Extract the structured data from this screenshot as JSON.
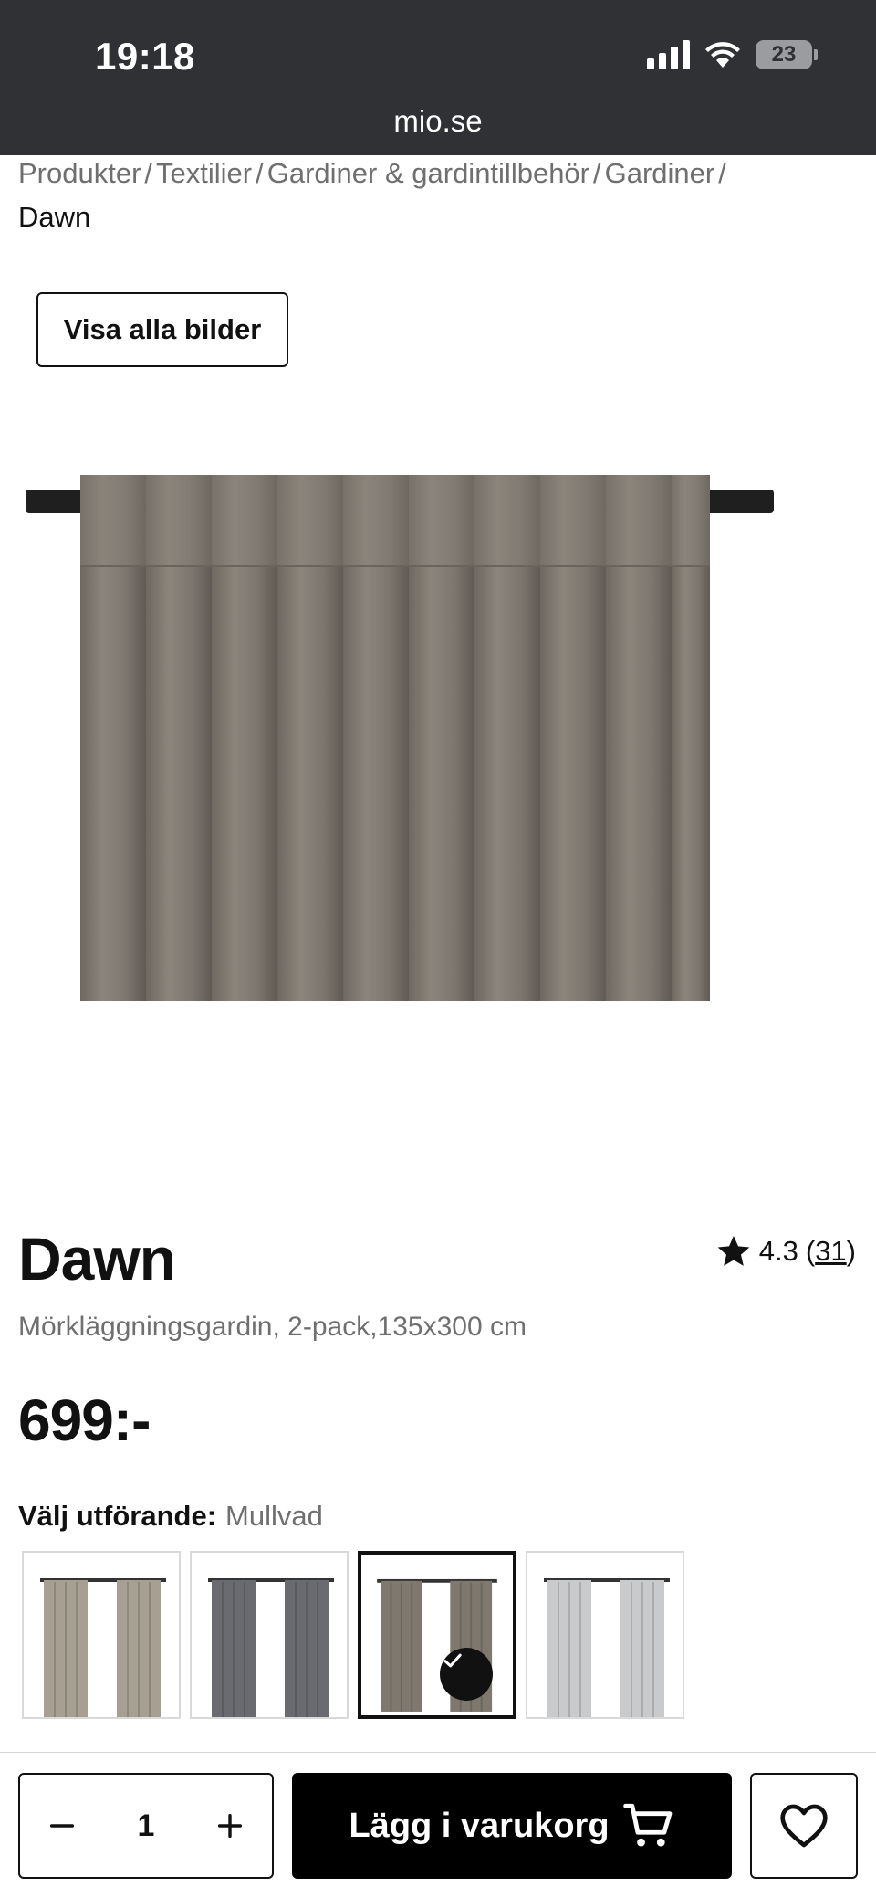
{
  "status_bar": {
    "time": "19:18",
    "battery": "23",
    "url": "mio.se"
  },
  "breadcrumb": {
    "items": [
      "Produkter",
      "Textilier",
      "Gardiner & gardintillbehör",
      "Gardiner"
    ],
    "separator": "/",
    "current": "Dawn"
  },
  "gallery": {
    "show_all_label": "Visa alla bilder"
  },
  "product": {
    "title": "Dawn",
    "rating_value": "4.3",
    "rating_count": "31",
    "subtitle": "Mörkläggningsgardin, 2-pack,135x300 cm",
    "price": "699:-"
  },
  "variants": {
    "label": "Välj utförande:",
    "selected_value": "Mullvad",
    "swatches": [
      {
        "color": "#a79f92",
        "selected": false
      },
      {
        "color": "#6a6b70",
        "selected": false
      },
      {
        "color": "#7f786f",
        "selected": true
      },
      {
        "color": "#c9cacb",
        "selected": false
      }
    ]
  },
  "bottom_bar": {
    "quantity": "1",
    "add_to_cart_label": "Lägg i varukorg"
  },
  "colors": {
    "status_bar_bg": "#2f3134",
    "curtain": "#7d776f",
    "accent": "#000000"
  },
  "icons": [
    "signal-icon",
    "wifi-icon",
    "battery-icon",
    "star-icon",
    "check-icon",
    "minus-icon",
    "plus-icon",
    "cart-icon",
    "heart-icon"
  ]
}
